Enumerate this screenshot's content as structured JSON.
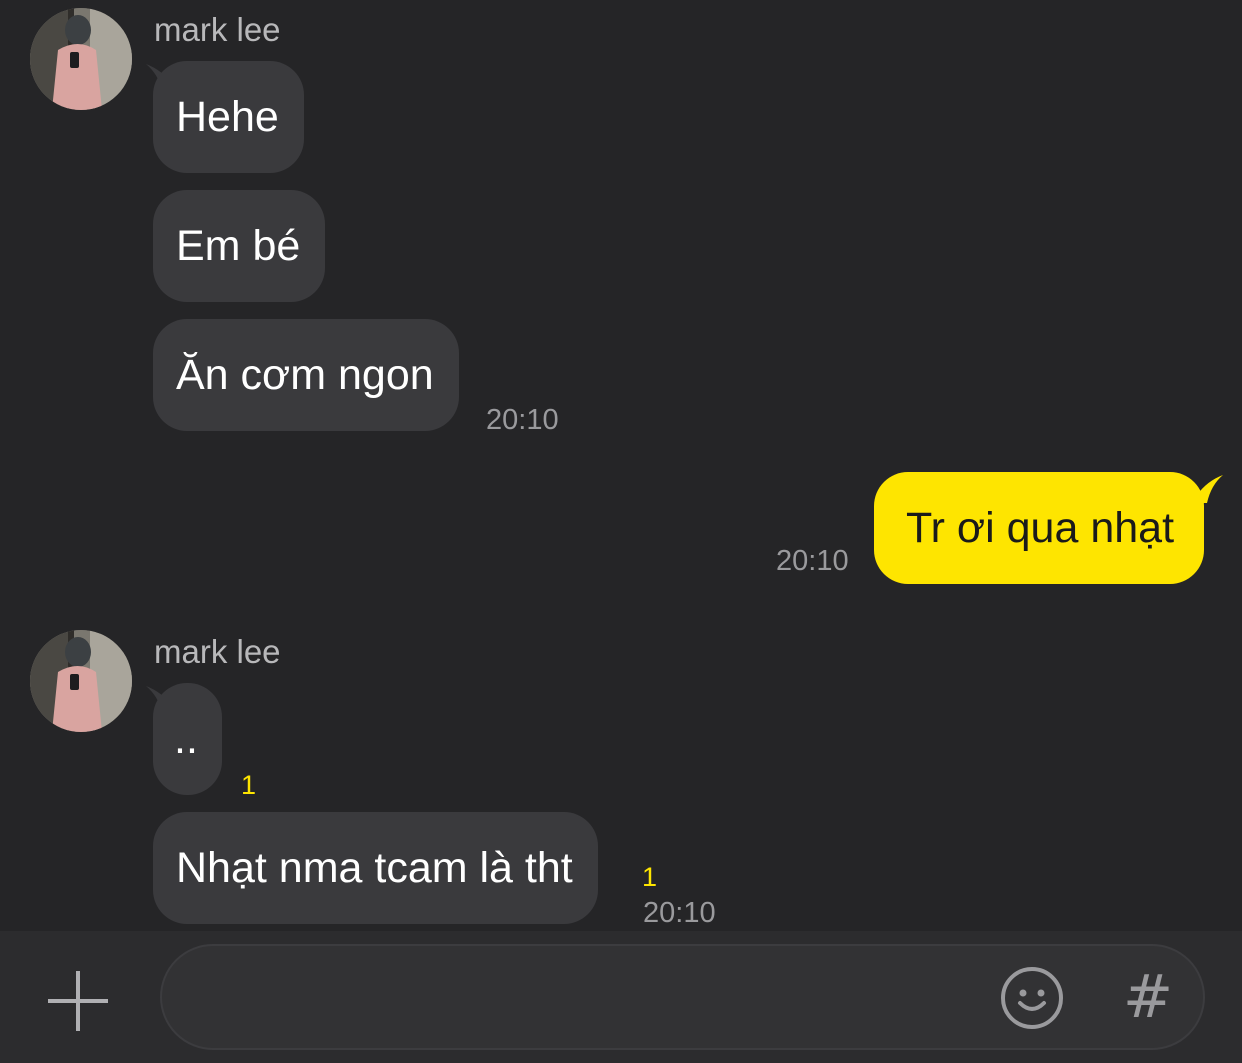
{
  "conversation": {
    "groups": [
      {
        "sender": "mark lee",
        "avatar_icon": "profile-photo",
        "messages": [
          {
            "text": "Hehe"
          },
          {
            "text": "Em bé"
          },
          {
            "text": "Ăn cơm ngon",
            "time": "20:10"
          }
        ]
      },
      {
        "sender": "me",
        "messages": [
          {
            "text": "Tr ơi qua nhạt",
            "time": "20:10"
          }
        ]
      },
      {
        "sender": "mark lee",
        "avatar_icon": "profile-photo",
        "messages": [
          {
            "text": "..",
            "unread": "1"
          },
          {
            "text": "Nhạt nma tcam là tht",
            "unread": "1",
            "time": "20:10"
          }
        ]
      }
    ]
  },
  "input_bar": {
    "plus_icon": "plus-icon",
    "placeholder": "",
    "emoji_icon": "emoji-icon",
    "hash_label": "#"
  },
  "colors": {
    "background": "#252527",
    "bubble_incoming": "#3a3a3d",
    "bubble_outgoing": "#fee500",
    "unread_badge": "#fee500",
    "timestamp": "#9a9a9d"
  }
}
